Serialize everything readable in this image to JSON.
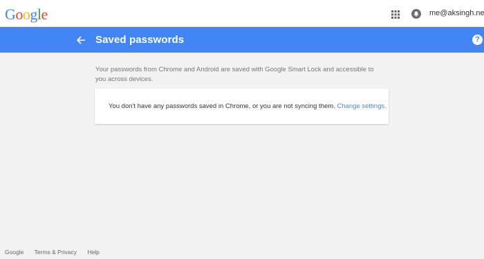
{
  "topbar": {
    "logo_letters": [
      {
        "char": "G",
        "color": "#4285f4"
      },
      {
        "char": "o",
        "color": "#ea4335"
      },
      {
        "char": "o",
        "color": "#fbbc05"
      },
      {
        "char": "g",
        "color": "#4285f4"
      },
      {
        "char": "l",
        "color": "#34a853"
      },
      {
        "char": "e",
        "color": "#ea4335"
      }
    ],
    "apps_icon": "apps-grid-icon",
    "notifications_icon": "notifications-bell-icon",
    "account_email": "me@aksingh.net",
    "account_caret": "▾"
  },
  "header": {
    "back_icon": "arrow-back-icon",
    "title": "Saved passwords",
    "help_icon_glyph": "?",
    "background": "#4285f4"
  },
  "main": {
    "intro": "Your passwords from Chrome and Android are saved with Google Smart Lock and accessible to you across devices.",
    "card_message": "You don't have any passwords saved in Chrome, or you are not syncing them.",
    "card_link": "Change settings."
  },
  "footer": {
    "links": [
      "Google",
      "Terms & Privacy",
      "Help"
    ]
  }
}
